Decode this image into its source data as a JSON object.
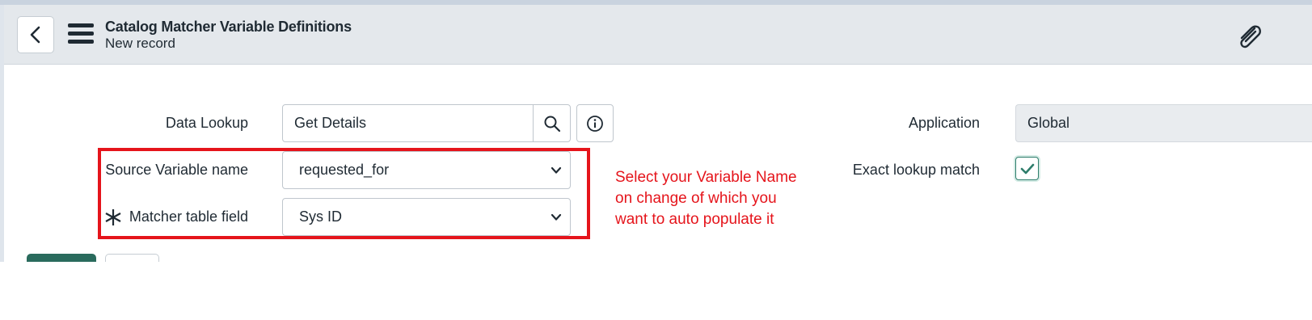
{
  "header": {
    "title": "Catalog Matcher Variable Definitions",
    "subtitle": "New record"
  },
  "form": {
    "data_lookup": {
      "label": "Data Lookup",
      "value": "Get Details"
    },
    "source_variable": {
      "label": "Source Variable name",
      "value": "requested_for"
    },
    "matcher_field": {
      "label": "Matcher table field",
      "value": "Sys ID",
      "mandatory": true
    },
    "application": {
      "label": "Application",
      "value": "Global"
    },
    "exact_match": {
      "label": "Exact lookup match",
      "checked": true
    }
  },
  "annotation": {
    "text": "Select your Variable Name on change of which you want to auto populate it",
    "color": "#e5141b"
  },
  "icons": {
    "back": "chevron-left-icon",
    "menu": "hamburger-icon",
    "attachment": "paperclip-icon",
    "search": "search-icon",
    "info": "info-icon",
    "dropdown": "chevron-down-icon",
    "check": "check-icon",
    "required": "asterisk-icon"
  },
  "colors": {
    "header_bg": "#e4e8ec",
    "accent": "#2a6b5d",
    "highlight": "#e5141b"
  }
}
